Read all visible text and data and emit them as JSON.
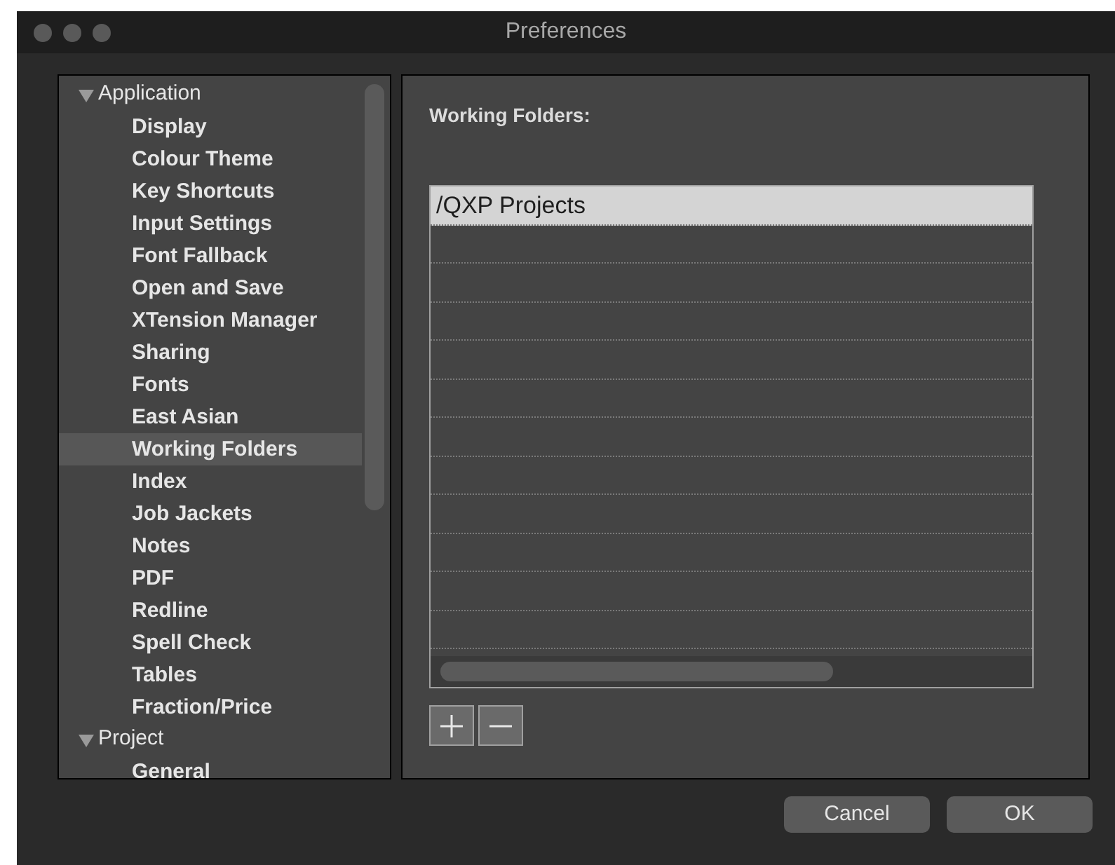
{
  "window": {
    "title": "Preferences"
  },
  "sidebar": {
    "items": [
      {
        "label": "Application",
        "expanded": true,
        "children": [
          {
            "label": "Display",
            "selected": false
          },
          {
            "label": "Colour Theme",
            "selected": false
          },
          {
            "label": "Key Shortcuts",
            "selected": false
          },
          {
            "label": "Input Settings",
            "selected": false
          },
          {
            "label": "Font Fallback",
            "selected": false
          },
          {
            "label": "Open and Save",
            "selected": false
          },
          {
            "label": "XTension Manager",
            "selected": false
          },
          {
            "label": "Sharing",
            "selected": false
          },
          {
            "label": "Fonts",
            "selected": false
          },
          {
            "label": "East Asian",
            "selected": false
          },
          {
            "label": "Working Folders",
            "selected": true
          },
          {
            "label": "Index",
            "selected": false
          },
          {
            "label": "Job Jackets",
            "selected": false
          },
          {
            "label": "Notes",
            "selected": false
          },
          {
            "label": "PDF",
            "selected": false
          },
          {
            "label": "Redline",
            "selected": false
          },
          {
            "label": "Spell Check",
            "selected": false
          },
          {
            "label": "Tables",
            "selected": false
          },
          {
            "label": "Fraction/Price",
            "selected": false
          }
        ]
      },
      {
        "label": "Project",
        "expanded": true,
        "children": [
          {
            "label": "General",
            "selected": false
          }
        ]
      }
    ]
  },
  "panel": {
    "heading": "Working Folders:",
    "folders": [
      {
        "path": "/QXP Projects",
        "selected": true
      }
    ]
  },
  "buttons": [
    {
      "label": "Cancel"
    },
    {
      "label": "OK"
    }
  ]
}
